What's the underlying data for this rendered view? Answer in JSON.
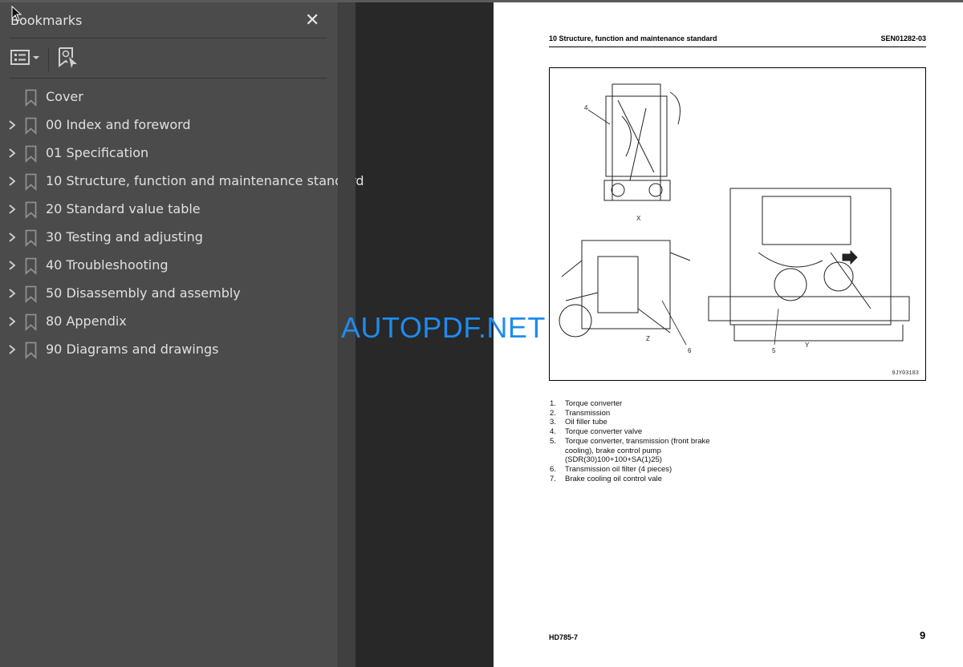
{
  "panel": {
    "title": "Bookmarks",
    "close_icon": "close-icon",
    "toolbar": {
      "options_icon": "list-options-icon",
      "find_icon": "bookmark-find-icon"
    },
    "items": [
      {
        "label": "Cover",
        "expandable": false
      },
      {
        "label": "00 Index and foreword",
        "expandable": true
      },
      {
        "label": "01 Specification",
        "expandable": true
      },
      {
        "label": "10 Structure, function and maintenance standard",
        "expandable": true
      },
      {
        "label": "20 Standard value table",
        "expandable": true
      },
      {
        "label": "30 Testing and adjusting",
        "expandable": true
      },
      {
        "label": "40 Troubleshooting",
        "expandable": true
      },
      {
        "label": "50 Disassembly and assembly",
        "expandable": true
      },
      {
        "label": "80 Appendix",
        "expandable": true
      },
      {
        "label": "90 Diagrams and drawings",
        "expandable": true
      }
    ]
  },
  "page": {
    "header_left": "10 Structure, function and maintenance standard",
    "header_right": "SEN01282-03",
    "figure": {
      "code": "9JY03183",
      "view_labels": [
        "X",
        "Z",
        "Y"
      ],
      "callouts": [
        "4",
        "6",
        "5"
      ]
    },
    "legend": [
      {
        "n": "1.",
        "text": "Torque converter"
      },
      {
        "n": "2.",
        "text": "Transmission"
      },
      {
        "n": "3.",
        "text": "Oil filler tube"
      },
      {
        "n": "4.",
        "text": "Torque converter valve"
      },
      {
        "n": "5.",
        "text": "Torque converter, transmission (front brake"
      },
      {
        "n": "",
        "text": "cooling), brake control pump"
      },
      {
        "n": "",
        "text": "(SDR(30)100+100+SA(1)25)"
      },
      {
        "n": "6.",
        "text": "Transmission oil filter (4 pieces)"
      },
      {
        "n": "7.",
        "text": "Brake cooling oil control vale"
      }
    ],
    "footer_left": "HD785-7",
    "page_number": "9"
  },
  "watermark": "AUTOPDF.NET",
  "colors": {
    "panel_bg": "#4b4b4b",
    "viewer_bg": "#282828",
    "watermark": "#1e8bf0"
  }
}
